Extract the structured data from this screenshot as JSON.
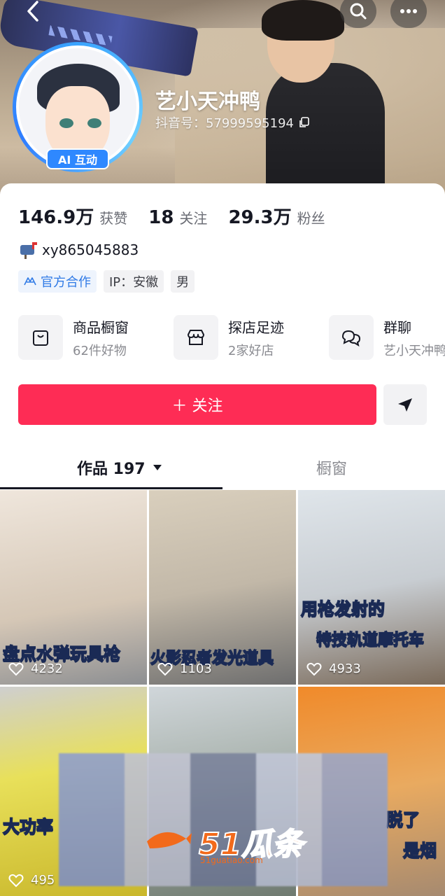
{
  "profile": {
    "name": "艺小天冲鸭",
    "douyin_id": "抖音号：57999595194",
    "ai_badge": "AI 互动",
    "bio": "xy865045883"
  },
  "stats": [
    {
      "num": "146.9万",
      "label": "获赞"
    },
    {
      "num": "18",
      "label": "关注"
    },
    {
      "num": "29.3万",
      "label": "粉丝"
    }
  ],
  "tags": {
    "official": "官方合作",
    "ip": "IP：安徽",
    "gender": "男"
  },
  "shortcuts": [
    {
      "title": "商品橱窗",
      "sub": "62件好物",
      "icon": "shopping-bag-icon"
    },
    {
      "title": "探店足迹",
      "sub": "2家好店",
      "icon": "store-icon"
    },
    {
      "title": "群聊",
      "sub": "艺小天冲鸭",
      "icon": "chat-bubbles-icon"
    }
  ],
  "actions": {
    "follow": "＋ 关注"
  },
  "tabs": {
    "works": "作品 197",
    "showcase": "橱窗"
  },
  "videos": [
    {
      "caption": "盘点水弹玩具枪",
      "likes": "4232"
    },
    {
      "caption": "火影忍者发光道具",
      "likes": "1103"
    },
    {
      "caption_line1": "用枪发射的",
      "caption_line2": "特技轨道摩托车",
      "likes": "4933"
    },
    {
      "caption": "大功率",
      "likes": "495"
    },
    {
      "caption": "",
      "likes": ""
    },
    {
      "caption_line1": "脱了",
      "caption_line2": "是烟",
      "likes": ""
    }
  ],
  "watermark": {
    "brand": "51瓜条",
    "url": "51guatiao.com"
  },
  "colors": {
    "accent": "#fe2c55",
    "official_blue": "#2f7ae6",
    "ai_badge": "#2e88ff"
  }
}
